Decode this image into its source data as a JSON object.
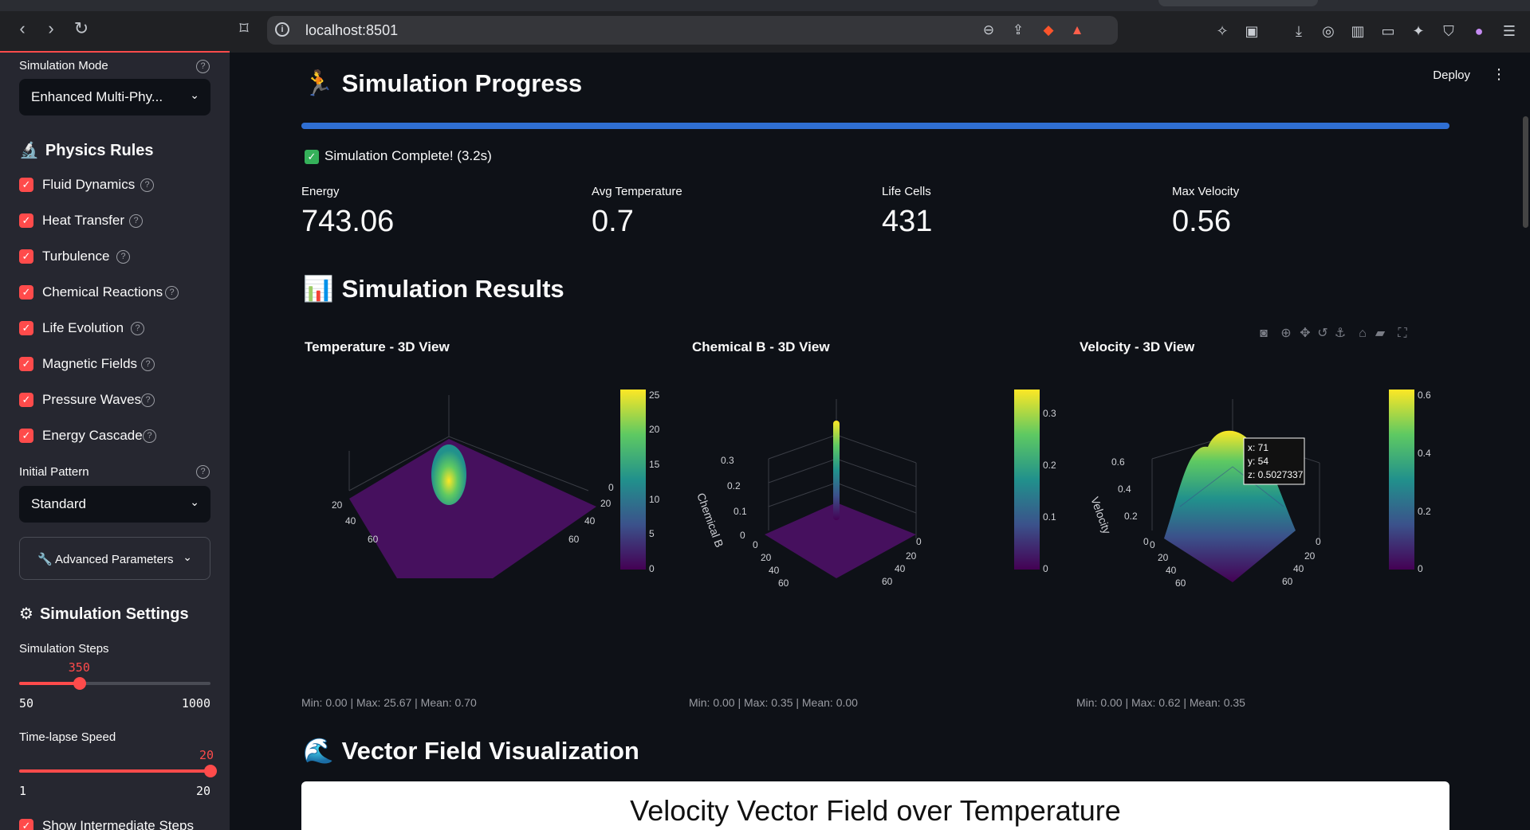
{
  "browser": {
    "url": "localhost:8501",
    "brave_badge": "1"
  },
  "sidebar": {
    "simulation_mode": {
      "label": "Simulation Mode",
      "value": "Enhanced Multi-Phy..."
    },
    "physics_rules": {
      "title": "Physics Rules",
      "items": [
        {
          "label": "Fluid Dynamics",
          "checked": true
        },
        {
          "label": "Heat Transfer",
          "checked": true
        },
        {
          "label": "Turbulence",
          "checked": true
        },
        {
          "label": "Chemical Reactions",
          "checked": true
        },
        {
          "label": "Life Evolution",
          "checked": true
        },
        {
          "label": "Magnetic Fields",
          "checked": true
        },
        {
          "label": "Pressure Waves",
          "checked": true
        },
        {
          "label": "Energy Cascade",
          "checked": true
        }
      ]
    },
    "initial_pattern": {
      "label": "Initial Pattern",
      "value": "Standard"
    },
    "advanced_parameters": "Advanced Parameters",
    "simulation_settings": {
      "title": "Simulation Settings",
      "steps": {
        "label": "Simulation Steps",
        "value": 350,
        "min": 50,
        "max": 1000
      },
      "timelapse": {
        "label": "Time-lapse Speed",
        "value": 20,
        "min": 1,
        "max": 20
      },
      "show_intermediate": "Show Intermediate Steps"
    }
  },
  "header": {
    "deploy": "Deploy"
  },
  "progress": {
    "title": "Simulation Progress",
    "fraction": 1.0,
    "status": "Simulation Complete! (3.2s)"
  },
  "metrics": [
    {
      "label": "Energy",
      "value": "743.06"
    },
    {
      "label": "Avg Temperature",
      "value": "0.7"
    },
    {
      "label": "Life Cells",
      "value": "431"
    },
    {
      "label": "Max Velocity",
      "value": "0.56"
    }
  ],
  "results": {
    "title": "Simulation Results",
    "plots": [
      {
        "title": "Temperature - 3D View",
        "stats": "Min: 0.00 | Max: 25.67 | Mean: 0.70",
        "colorbar_ticks": [
          "25",
          "20",
          "15",
          "10",
          "5",
          "0"
        ],
        "axis_ticks": [
          "0",
          "20",
          "40",
          "60",
          "20",
          "40",
          "60"
        ],
        "zlabel": ""
      },
      {
        "title": "Chemical B - 3D View",
        "stats": "Min: 0.00 | Max: 0.35 | Mean: 0.00",
        "colorbar_ticks": [
          "0.3",
          "0.2",
          "0.1",
          "0"
        ],
        "axis_ticks": [
          "0",
          "20",
          "40",
          "60",
          "0",
          "20",
          "40",
          "60"
        ],
        "zticks": [
          "0.3",
          "0.2",
          "0.1",
          "0"
        ],
        "zlabel": "Chemical B"
      },
      {
        "title": "Velocity - 3D View",
        "stats": "Min: 0.00 | Max: 0.62 | Mean: 0.35",
        "colorbar_ticks": [
          "0.6",
          "0.4",
          "0.2",
          "0"
        ],
        "axis_ticks": [
          "0",
          "20",
          "40",
          "60",
          "0",
          "20",
          "40",
          "60"
        ],
        "zticks": [
          "0.6",
          "0.4",
          "0.2",
          "0"
        ],
        "zlabel": "Velocity",
        "tooltip": {
          "x": "x: 71",
          "y": "y: 54",
          "z": "z: 0.5027337"
        }
      }
    ]
  },
  "vector_field": {
    "title": "Vector Field Visualization",
    "figure_title": "Velocity Vector Field over Temperature"
  },
  "icons": {
    "back": "arrow-left-icon",
    "forward": "arrow-right-icon",
    "reload": "reload-icon",
    "bookmark": "bookmark-icon",
    "help": "help-icon",
    "dropdown": "chevron-down-icon"
  },
  "colors": {
    "accent": "#ff4b4b",
    "progress": "#2f6fd3",
    "background": "#0e1117",
    "sidebar": "#262730"
  }
}
